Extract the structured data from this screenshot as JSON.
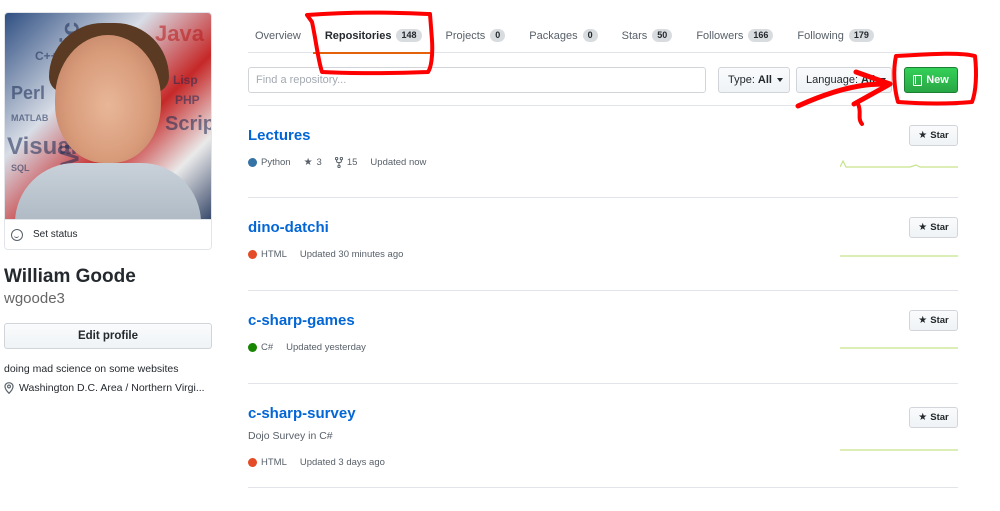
{
  "profile": {
    "set_status": "Set status",
    "name": "William Goode",
    "username": "wgoode3",
    "edit_profile": "Edit profile",
    "bio": "doing mad science on some websites",
    "location": "Washington D.C. Area / Northern Virgi..."
  },
  "tabs": [
    {
      "label": "Overview",
      "count": null
    },
    {
      "label": "Repositories",
      "count": "148",
      "selected": true
    },
    {
      "label": "Projects",
      "count": "0"
    },
    {
      "label": "Packages",
      "count": "0"
    },
    {
      "label": "Stars",
      "count": "50"
    },
    {
      "label": "Followers",
      "count": "166"
    },
    {
      "label": "Following",
      "count": "179"
    }
  ],
  "filters": {
    "search_placeholder": "Find a repository...",
    "type_label": "Type:",
    "type_value": "All",
    "language_label": "Language:",
    "language_value": "All",
    "new_button": "New"
  },
  "repos": [
    {
      "name": "Lectures",
      "description": "",
      "language": "Python",
      "lang_color": "#3572A5",
      "stars": "3",
      "forks": "15",
      "updated": "Updated now"
    },
    {
      "name": "dino-datchi",
      "description": "",
      "language": "HTML",
      "lang_color": "#e34c26",
      "stars": null,
      "forks": null,
      "updated": "Updated 30 minutes ago"
    },
    {
      "name": "c-sharp-games",
      "description": "",
      "language": "C#",
      "lang_color": "#178600",
      "stars": null,
      "forks": null,
      "updated": "Updated yesterday"
    },
    {
      "name": "c-sharp-survey",
      "description": "Dojo Survey in C#",
      "language": "HTML",
      "lang_color": "#e34c26",
      "stars": null,
      "forks": null,
      "updated": "Updated 3 days ago"
    }
  ],
  "star_button": "Star",
  "colors": {
    "link": "#0366d6",
    "selected_tab_underline": "#e36209",
    "new_button": "#28a745",
    "annotation": "#ff0000"
  },
  "avatar_words": [
    "VisualBasic",
    "Java",
    "Perl",
    "C++",
    "Lisp",
    "PHP",
    "SQL",
    "MATLAB",
    "Script"
  ]
}
